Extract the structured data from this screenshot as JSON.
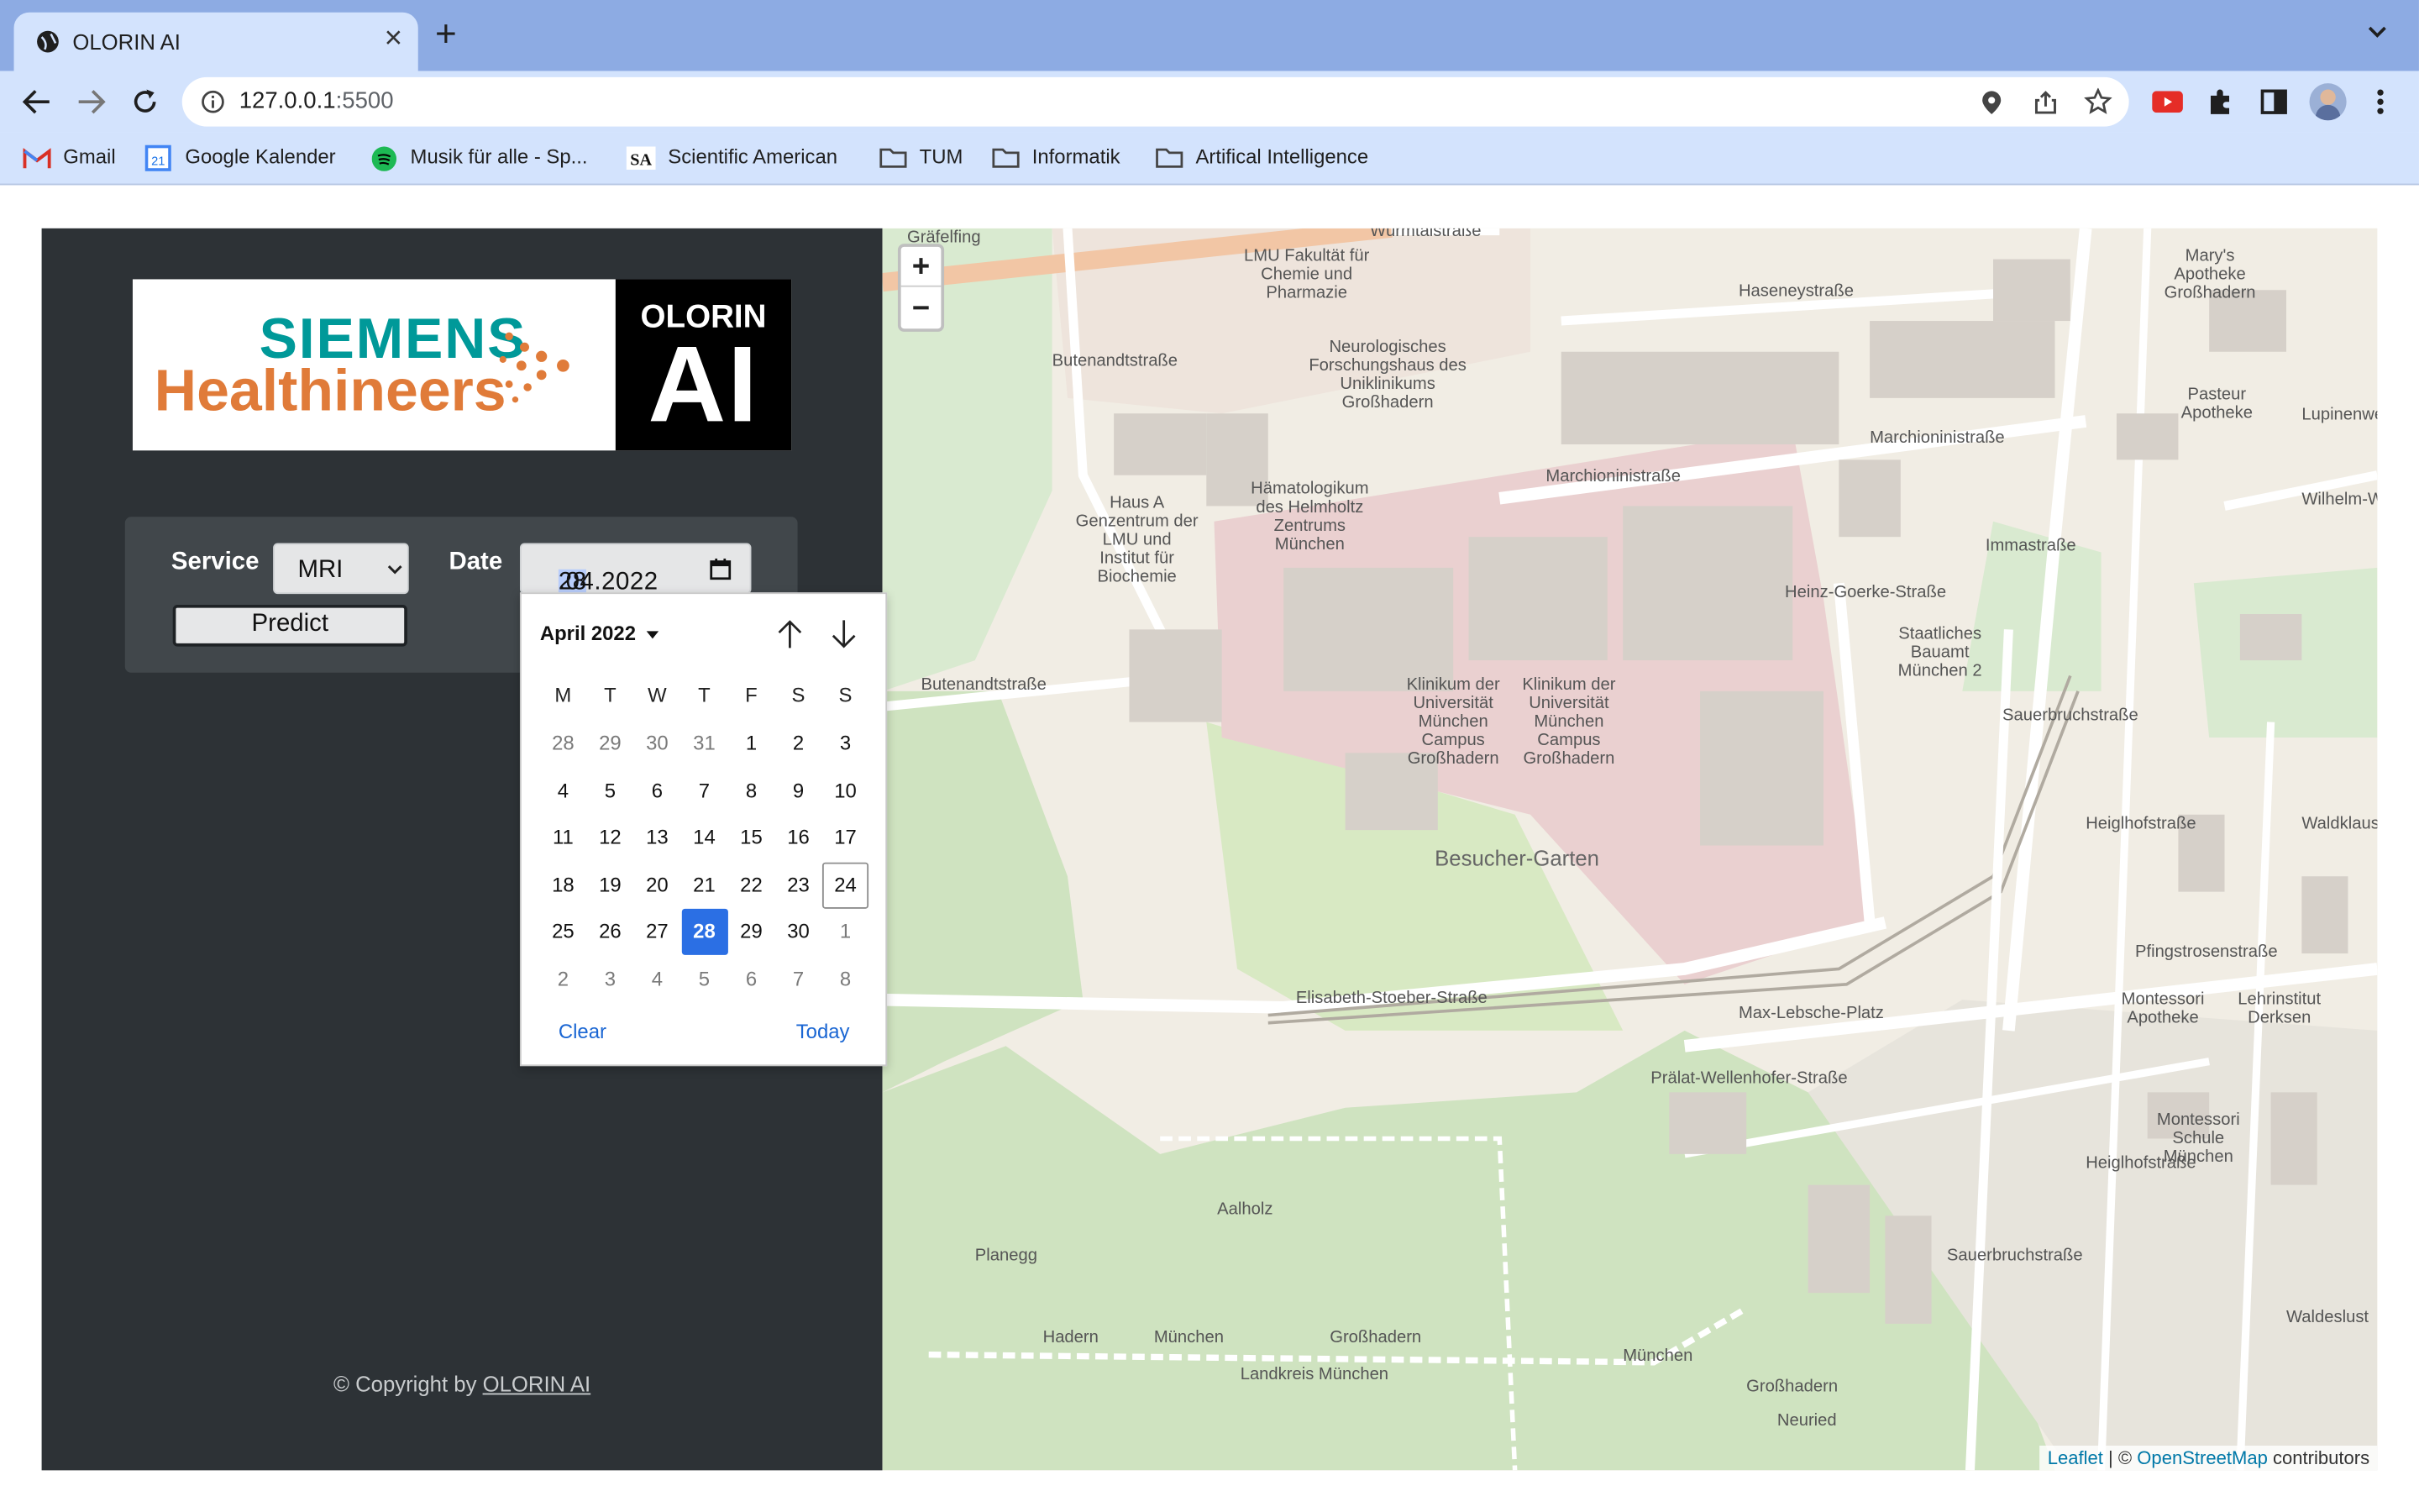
{
  "browser": {
    "tab_title": "OLORIN AI",
    "url_host": "127.0.0.1",
    "url_port": ":5500",
    "bookmarks": [
      "Gmail",
      "Google Kalender",
      "Musik für alle - Sp...",
      "Scientific American",
      "TUM",
      "Informatik",
      "Artifical Intelligence"
    ]
  },
  "logo": {
    "siemens": "SIEMENS",
    "healthineers": "Healthineers",
    "olorin": "OLORIN",
    "ai": "AI"
  },
  "form": {
    "service_label": "Service",
    "service_value": "MRI",
    "date_label": "Date",
    "date_day": "28",
    "date_rest": ".04.2022",
    "predict_label": "Predict"
  },
  "calendar": {
    "month_label": "April 2022",
    "weekdays": [
      "M",
      "T",
      "W",
      "T",
      "F",
      "S",
      "S"
    ],
    "weeks": [
      [
        "28",
        "29",
        "30",
        "31",
        "1",
        "2",
        "3"
      ],
      [
        "4",
        "5",
        "6",
        "7",
        "8",
        "9",
        "10"
      ],
      [
        "11",
        "12",
        "13",
        "14",
        "15",
        "16",
        "17"
      ],
      [
        "18",
        "19",
        "20",
        "21",
        "22",
        "23",
        "24"
      ],
      [
        "25",
        "26",
        "27",
        "28",
        "29",
        "30",
        "1"
      ],
      [
        "2",
        "3",
        "4",
        "5",
        "6",
        "7",
        "8"
      ]
    ],
    "selected": "28",
    "today": "24",
    "clear_label": "Clear",
    "today_label": "Today"
  },
  "footer": {
    "prefix": "© Copyright by ",
    "brand": "OLORIN AI"
  },
  "map": {
    "attribution_leaflet": "Leaflet",
    "attribution_sep": " | © ",
    "attribution_osm": "OpenStreetMap",
    "attribution_suffix": " contributors",
    "labels": [
      "Würmtalstraße",
      "Haseneystraße",
      "Marchioninistraße",
      "Butenandtstraße",
      "Heinz-Goerke-Straße",
      "Elisabeth-Stoeber-Straße",
      "Max-Lebsche-Platz",
      "Prälat-Wellenhofer-Straße",
      "Pfingstrosenstraße",
      "Sauerbruchstraße",
      "Immastraße",
      "Heiglhofstraße",
      "Waldklausenweg",
      "Lupinenweg",
      "Wilhelm-We",
      "Besucher-Garten",
      "Aalholz",
      "Großhadern",
      "München",
      "Landkreis München",
      "Hadern",
      "Planegg",
      "Neuried",
      "Waldeslust",
      "Gräfelfing",
      "LMU Fakultät für Chemie und Pharmazie",
      "Neurologisches Forschungshaus des Uniklinikums Großhadern",
      "Hämatologikum des Helmholtz Zentrums München",
      "Haus A Genzentrum der LMU und Institut für Biochemie",
      "Klinikum der Universität München Campus Großhadern",
      "Staatliches Bauamt München 2",
      "Mary's Apotheke Großhadern",
      "Pasteur Apotheke",
      "Montessori Apotheke",
      "Lehrinstitut Derksen",
      "Montessori Schule München"
    ]
  },
  "colors": {
    "sidebar": "#2d3236",
    "form": "#41474b",
    "accent": "#2b6fe4",
    "siemens_teal": "#009999",
    "healthineers_orange": "#e07b39"
  }
}
